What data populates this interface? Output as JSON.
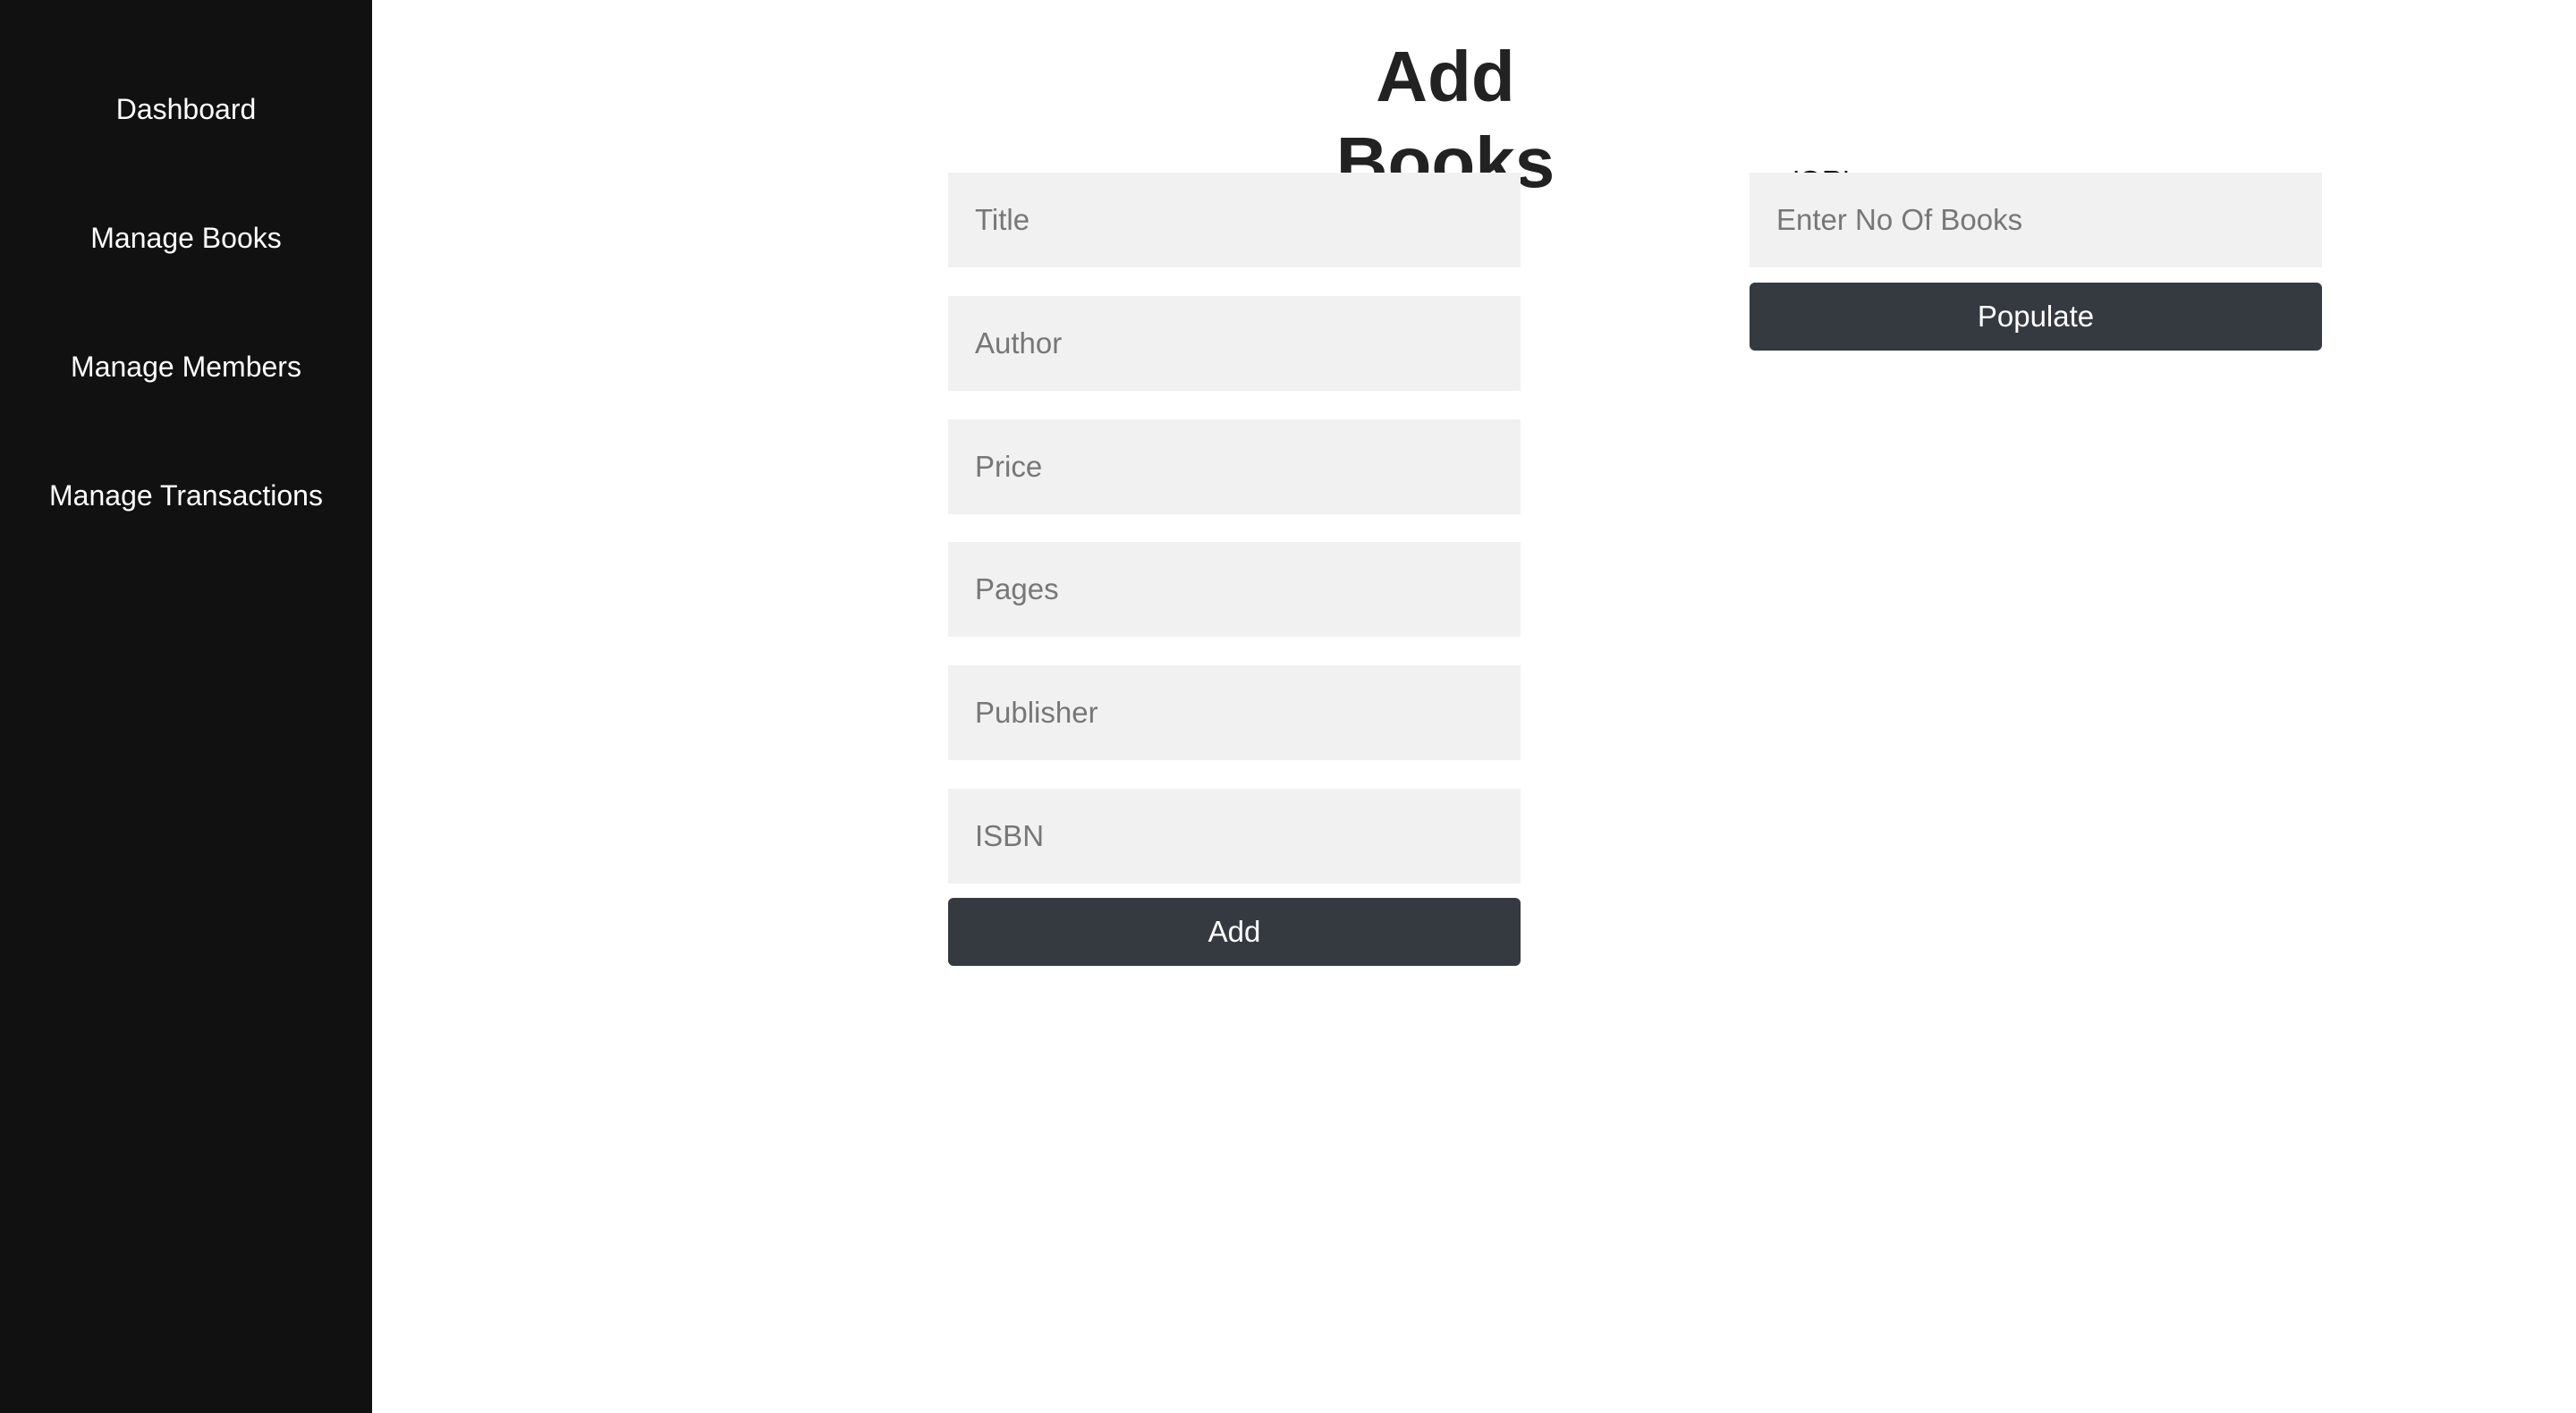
{
  "sidebar": {
    "items": [
      {
        "label": "Dashboard"
      },
      {
        "label": "Manage Books"
      },
      {
        "label": "Manage Members"
      },
      {
        "label": "Manage Transactions"
      }
    ]
  },
  "main": {
    "title": "Add Books",
    "form": {
      "fields": [
        {
          "placeholder": "Title",
          "value": ""
        },
        {
          "placeholder": "Author",
          "value": ""
        },
        {
          "placeholder": "Price",
          "value": ""
        },
        {
          "placeholder": "Pages",
          "value": ""
        },
        {
          "placeholder": "Publisher",
          "value": ""
        },
        {
          "placeholder": "ISBN",
          "value": ""
        }
      ],
      "add_label": "Add"
    },
    "separator": "'OR'",
    "populate": {
      "placeholder": "Enter No Of Books",
      "value": "",
      "button_label": "Populate"
    }
  },
  "colors": {
    "sidebar_bg": "#111111",
    "input_bg": "#f1f1f1",
    "button_bg": "#343a40"
  }
}
